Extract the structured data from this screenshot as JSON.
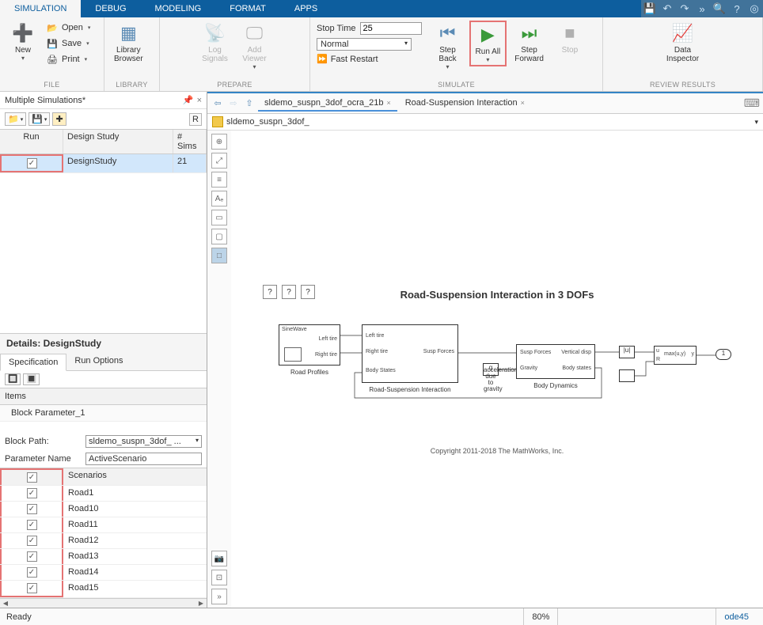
{
  "menubar": {
    "tabs": [
      "SIMULATION",
      "DEBUG",
      "MODELING",
      "FORMAT",
      "APPS"
    ]
  },
  "ribbon": {
    "file": {
      "label": "FILE",
      "new": "New",
      "open": "Open",
      "save": "Save",
      "print": "Print"
    },
    "library": {
      "label": "LIBRARY",
      "btn": "Library\nBrowser"
    },
    "prepare": {
      "label": "PREPARE",
      "log": "Log\nSignals",
      "viewer": "Add\nViewer"
    },
    "simulate": {
      "label": "SIMULATE",
      "stop_time_label": "Stop Time",
      "stop_time": "25",
      "mode": "Normal",
      "fast_restart": "Fast Restart",
      "step_back": "Step\nBack",
      "run_all": "Run All",
      "step_fwd": "Step\nForward",
      "stop": "Stop"
    },
    "review": {
      "label": "REVIEW RESULTS",
      "inspector": "Data\nInspector"
    }
  },
  "left_panel": {
    "title": "Multiple Simulations*",
    "refresh_btn": "R",
    "grid": {
      "headers": {
        "run": "Run",
        "design": "Design Study",
        "sims": "# Sims"
      },
      "row": {
        "design": "DesignStudy",
        "sims": "21"
      }
    },
    "details_title": "Details: DesignStudy",
    "tabs": {
      "spec": "Specification",
      "opts": "Run Options"
    },
    "items_label": "Items",
    "bp_item": "Block Parameter_1",
    "block_path_label": "Block Path:",
    "block_path": "sldemo_suspn_3dof_ ...",
    "param_name_label": "Parameter Name",
    "param_name": "ActiveScenario",
    "scenarios_header": "Scenarios",
    "scenarios": [
      "Road1",
      "Road10",
      "Road11",
      "Road12",
      "Road13",
      "Road14",
      "Road15"
    ]
  },
  "canvas": {
    "tabs": {
      "t1": "sldemo_suspn_3dof_ocra_21b",
      "t2": "Road-Suspension Interaction"
    },
    "breadcrumb": "sldemo_suspn_3dof_",
    "model_title": "Road-Suspension Interaction in 3 DOFs",
    "blocks": {
      "sinewave": "SineWave",
      "road_profiles": "Road Profiles",
      "left_tire": "Left tire",
      "right_tire": "Right tire",
      "body_states": "Body States",
      "susp_forces": "Susp Forces",
      "rsi": "Road-Suspension Interaction",
      "g": "g",
      "accel": "acceleration\ndue to gravity",
      "gravity": "Gravity",
      "vertical": "Vertical disp",
      "body_states2": "Body states",
      "body_dyn": "Body Dynamics",
      "abs": "|u|",
      "u": "u",
      "r": "R",
      "max": "max(u,y)",
      "y": "y",
      "out": "1"
    },
    "copyright": "Copyright 2011-2018 The MathWorks, Inc."
  },
  "status": {
    "ready": "Ready",
    "zoom": "80%",
    "solver": "ode45"
  }
}
